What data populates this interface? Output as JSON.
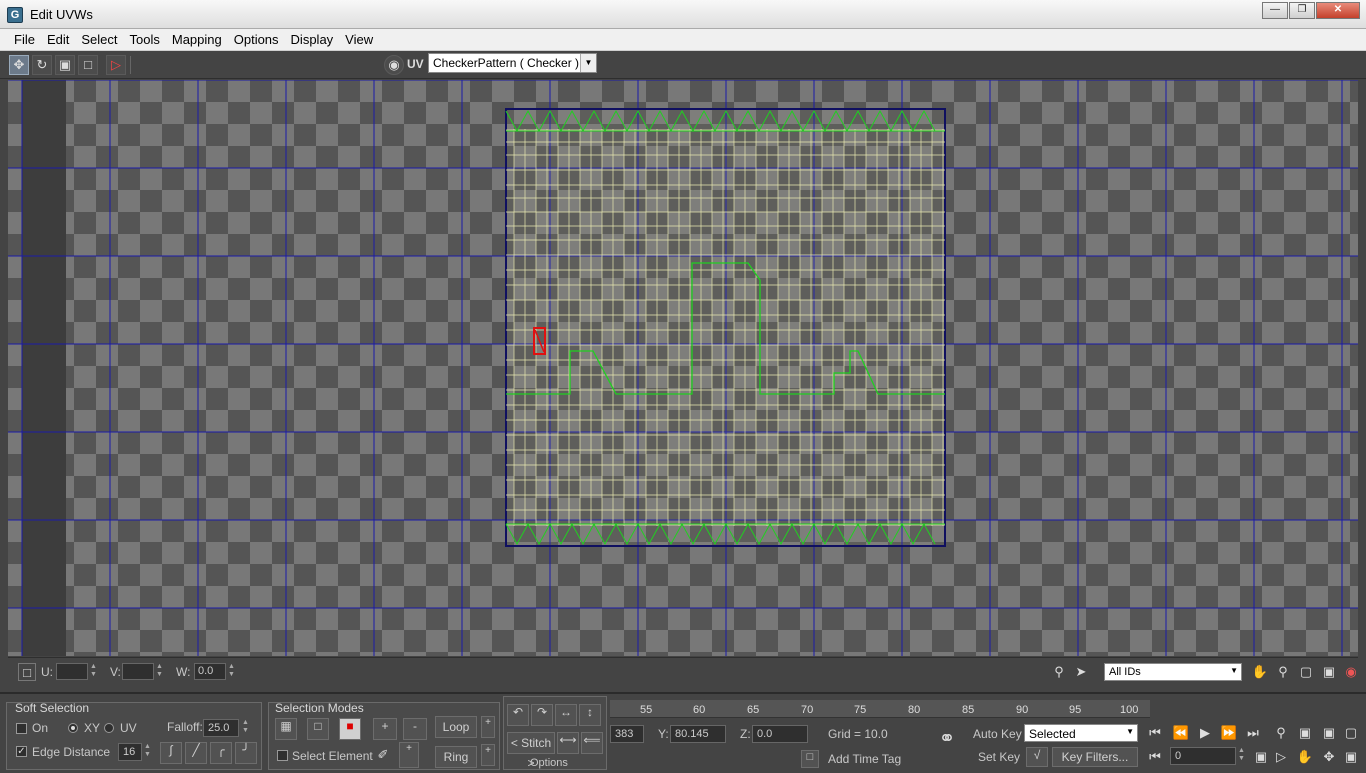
{
  "window": {
    "title": "Edit UVWs"
  },
  "menu": [
    "File",
    "Edit",
    "Select",
    "Tools",
    "Mapping",
    "Options",
    "Display",
    "View"
  ],
  "toolbar": {
    "tools": [
      "move-icon",
      "rotate-icon",
      "scale-icon",
      "freeform-icon",
      "mirror-icon"
    ],
    "uv_label": "UV",
    "texture_combo": "CheckerPattern  ( Checker )"
  },
  "status": {
    "u_label": "U:",
    "u_value": "",
    "v_label": "V:",
    "v_value": "",
    "w_label": "W:",
    "w_value": "0.0",
    "id_filter": "All IDs"
  },
  "soft_selection": {
    "title": "Soft Selection",
    "on_label": "On",
    "xy_label": "XY",
    "uv_label": "UV",
    "falloff_label": "Falloff:",
    "falloff_value": "25.0",
    "edge_distance_label": "Edge Distance",
    "edge_distance_value": "16"
  },
  "selection_modes": {
    "title": "Selection Modes",
    "select_element_label": "Select Element",
    "plus": "+",
    "minus": "-",
    "loop": "Loop",
    "ring": "Ring"
  },
  "stitch": {
    "label": "< Stitch >",
    "options": "Options"
  },
  "timeline": {
    "ticks": [
      "55",
      "60",
      "65",
      "70",
      "75",
      "80",
      "85",
      "90",
      "95",
      "100"
    ]
  },
  "coords": {
    "x_value": "383",
    "y_label": "Y:",
    "y_value": "80.145",
    "z_label": "Z:",
    "z_value": "0.0",
    "grid": "Grid = 10.0",
    "add_time_tag": "Add Time Tag"
  },
  "animation": {
    "auto_key": "Auto Key",
    "selected": "Selected",
    "set_key": "Set Key",
    "key_filters": "Key Filters...",
    "frame": "0"
  },
  "colors": {
    "grid_line": "#1a1aa8",
    "uv_edge": "#e8e8b0",
    "uv_seam": "#20d020",
    "selected": "#e01010"
  }
}
